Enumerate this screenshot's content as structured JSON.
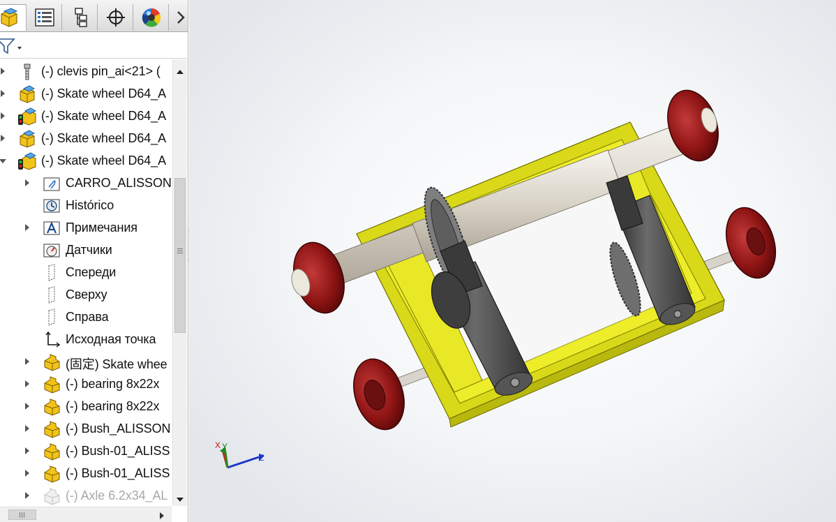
{
  "tabs": [
    {
      "name": "feature-manager-tab",
      "icon": "parts-cube-icon"
    },
    {
      "name": "property-manager-tab",
      "icon": "property-list-icon"
    },
    {
      "name": "configuration-manager-tab",
      "icon": "configuration-tree-icon"
    },
    {
      "name": "dimxpert-manager-tab",
      "icon": "crosshair-icon"
    },
    {
      "name": "display-manager-tab",
      "icon": "color-sphere-icon"
    }
  ],
  "tree": {
    "items": [
      {
        "label": "(-) clevis pin_ai<21> (",
        "icon": "pin-icon",
        "expand": "collapsed",
        "indent": 0
      },
      {
        "label": "(-) Skate wheel D64_A",
        "icon": "subassembly-icon",
        "expand": "collapsed",
        "indent": 0
      },
      {
        "label": "(-) Skate wheel D64_A",
        "icon": "subassembly-traffic-icon",
        "expand": "collapsed",
        "indent": 0
      },
      {
        "label": "(-) Skate wheel D64_A",
        "icon": "subassembly-icon",
        "expand": "collapsed",
        "indent": 0
      },
      {
        "label": "(-) Skate wheel D64_A",
        "icon": "subassembly-traffic-icon",
        "expand": "expanded",
        "indent": 0
      },
      {
        "label": "CARRO_ALISSON",
        "icon": "attachment-folder-icon",
        "expand": "collapsed",
        "indent": 1
      },
      {
        "label": "Histórico",
        "icon": "history-icon",
        "expand": "none",
        "indent": 1
      },
      {
        "label": "Примечания",
        "icon": "annotations-icon",
        "expand": "collapsed",
        "indent": 1
      },
      {
        "label": "Датчики",
        "icon": "sensor-icon",
        "expand": "none",
        "indent": 1
      },
      {
        "label": "Спереди",
        "icon": "plane-icon",
        "expand": "none",
        "indent": 1
      },
      {
        "label": "Сверху",
        "icon": "plane-icon",
        "expand": "none",
        "indent": 1
      },
      {
        "label": "Справа",
        "icon": "plane-icon",
        "expand": "none",
        "indent": 1
      },
      {
        "label": "Исходная точка",
        "icon": "origin-icon",
        "expand": "none",
        "indent": 1
      },
      {
        "label": "(固定) Skate whee",
        "icon": "part-icon",
        "expand": "collapsed",
        "indent": 1
      },
      {
        "label": "(-) bearing 8x22x",
        "icon": "part-icon",
        "expand": "collapsed",
        "indent": 1
      },
      {
        "label": "(-) bearing 8x22x",
        "icon": "part-icon",
        "expand": "collapsed",
        "indent": 1
      },
      {
        "label": "(-) Bush_ALISSON",
        "icon": "part-icon",
        "expand": "collapsed",
        "indent": 1
      },
      {
        "label": "(-) Bush-01_ALISS",
        "icon": "part-icon",
        "expand": "collapsed",
        "indent": 1
      },
      {
        "label": "(-) Bush-01_ALISS",
        "icon": "part-icon",
        "expand": "collapsed",
        "indent": 1
      },
      {
        "label": "(-) Axle 6.2x34_AL",
        "icon": "part-suppressed-icon",
        "expand": "collapsed",
        "indent": 1,
        "dim": true
      }
    ]
  },
  "triad": {
    "x": "X",
    "y": "Y",
    "z": "Z"
  },
  "colors": {
    "frame_yellow": "#e6e621",
    "wheel_red": "#8e1414",
    "motor_gray": "#4a4a4a",
    "axle_white": "#e4e0d8",
    "part_icon_yellow": "#f2c319"
  }
}
